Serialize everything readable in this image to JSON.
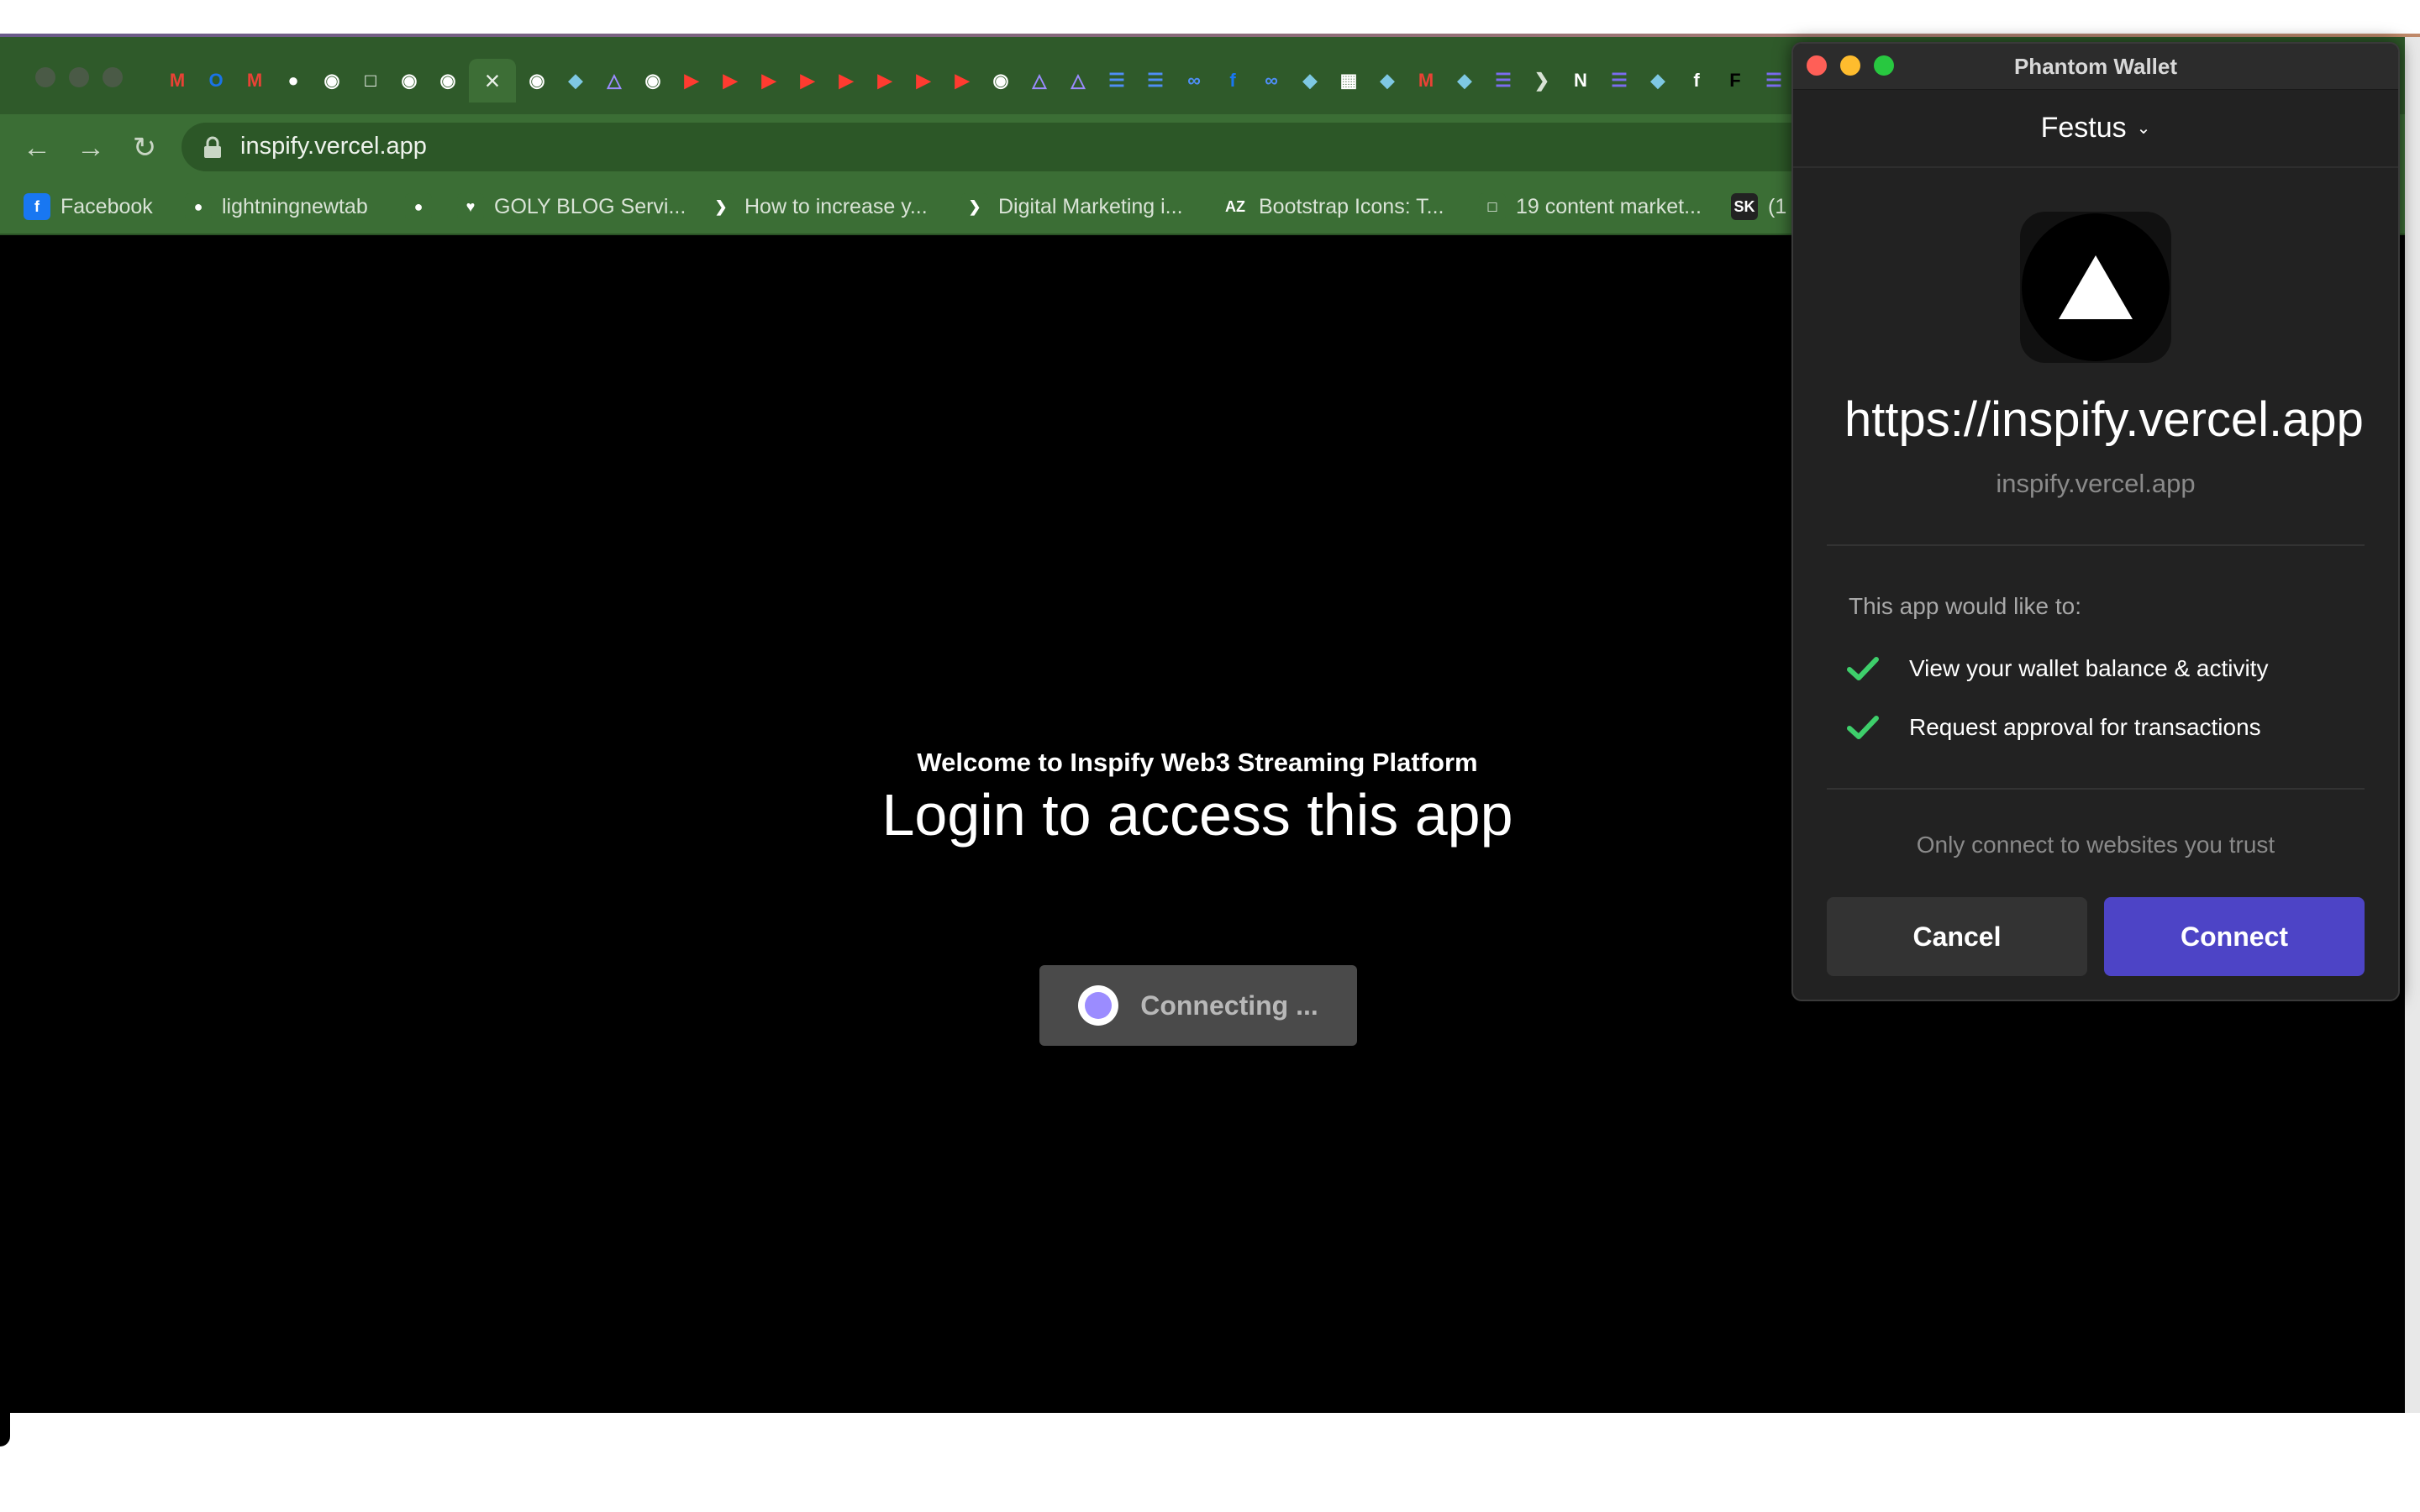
{
  "browser": {
    "tab_icons": [
      "gmail-icon",
      "outlook-icon",
      "gmail-icon",
      "globe-icon",
      "github-icon",
      "codepen-icon",
      "github-icon",
      "github-icon",
      "close-icon",
      "github-icon",
      "app-icon",
      "pixel-icon",
      "github-icon",
      "youtube-icon",
      "youtube-icon",
      "youtube-icon",
      "youtube-icon",
      "youtube-icon",
      "youtube-icon",
      "youtube-icon",
      "youtube-icon",
      "github-icon",
      "pixel-icon",
      "pixel-icon",
      "docs-icon",
      "docs-icon",
      "meta-icon",
      "facebook-icon",
      "meta-icon",
      "app-icon",
      "qr-icon",
      "app-icon",
      "gmail-icon",
      "app-icon",
      "list-icon",
      "arrow-icon",
      "notion-icon",
      "list-icon",
      "app-icon",
      "flip-icon",
      "fc-icon",
      "list-icon"
    ],
    "address": "inspify.vercel.app",
    "bookmarks": [
      {
        "icon": "facebook-icon",
        "label": "Facebook"
      },
      {
        "icon": "globe-icon",
        "label": "lightningnewtab"
      },
      {
        "icon": "globe-icon",
        "label": ""
      },
      {
        "icon": "heart-icon",
        "label": "GOLY BLOG Servi..."
      },
      {
        "icon": "arrow-icon",
        "label": "How to increase y..."
      },
      {
        "icon": "arrow-icon",
        "label": "Digital Marketing i..."
      },
      {
        "icon": "az-icon",
        "label": "Bootstrap Icons: T..."
      },
      {
        "icon": "seo-icon",
        "label": "19 content market..."
      },
      {
        "icon": "sk-icon",
        "label": "(1"
      }
    ]
  },
  "page": {
    "welcome": "Welcome to Inspify Web3 Streaming Platform",
    "title": "Login to access this app",
    "button_label": "Connecting ..."
  },
  "phantom": {
    "window_title": "Phantom Wallet",
    "account": "Festus",
    "site_url": "https://inspify.vercel.app",
    "site_domain": "inspify.vercel.app",
    "permissions_title": "This app would like to:",
    "permissions": [
      "View your wallet balance & activity",
      "Request approval for transactions"
    ],
    "trust_note": "Only connect to websites you trust",
    "cancel_label": "Cancel",
    "connect_label": "Connect",
    "accent_color": "#4d44c6"
  }
}
